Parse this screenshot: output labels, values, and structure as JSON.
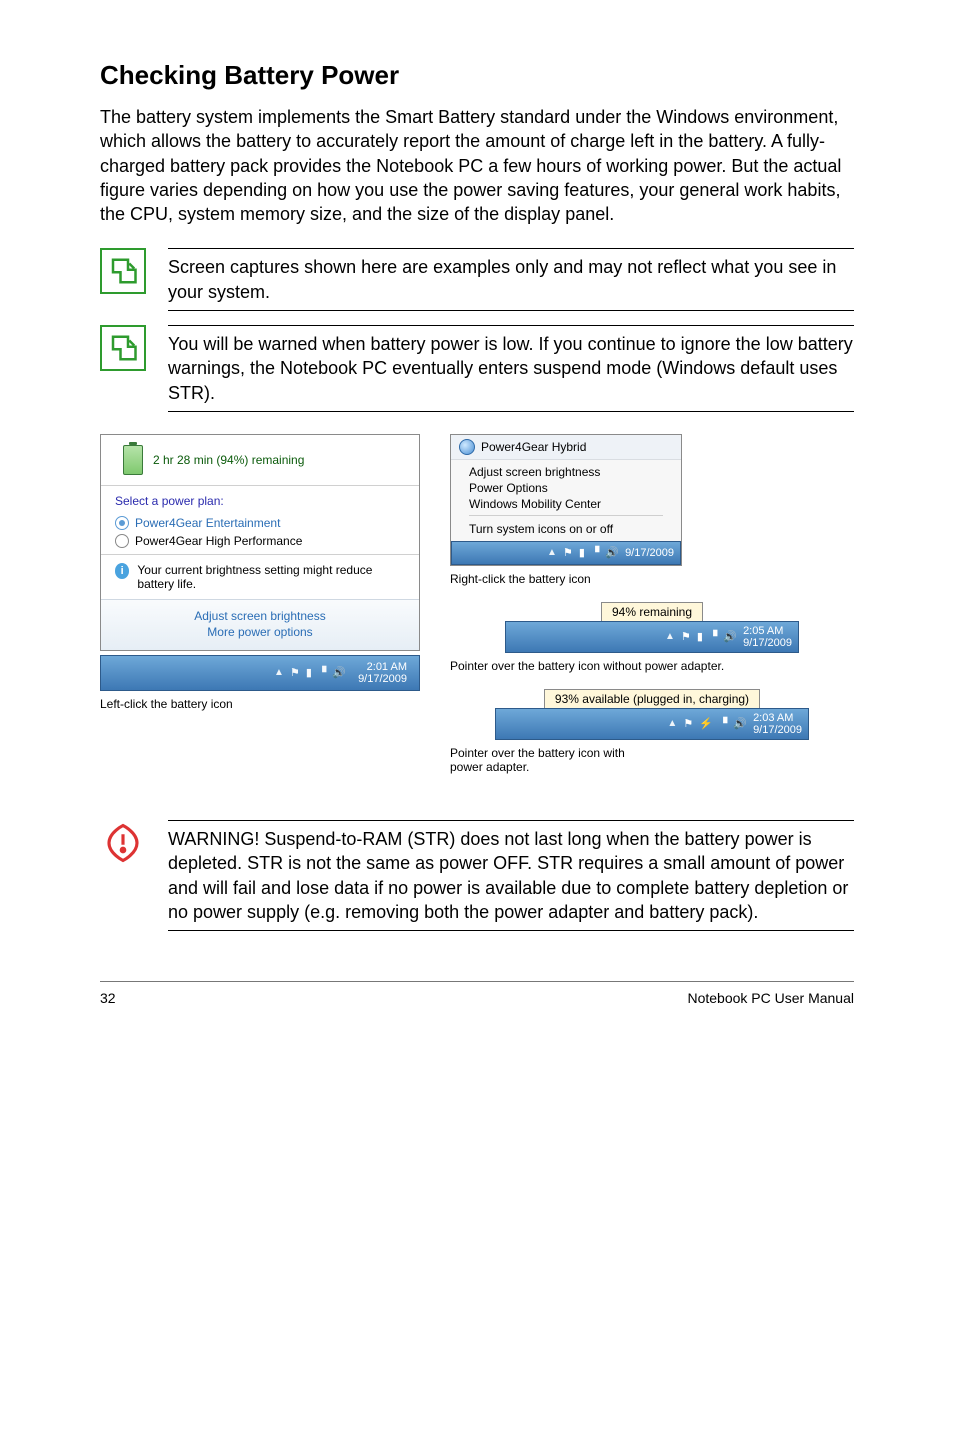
{
  "title": "Checking Battery Power",
  "intro": "The battery system implements the Smart Battery standard under the Windows environment, which allows the battery to accurately report the amount of charge left in the battery. A fully-charged battery pack provides the Notebook PC a few hours of working power. But the actual figure varies depending on how you use the power saving features, your general work habits, the CPU, system memory size, and the size of the display panel.",
  "notes": {
    "note1": "Screen captures shown here are examples only and may not reflect what you see in your system.",
    "note2": "You will be warned when battery power is low. If you continue to ignore the low battery warnings, the Notebook PC eventually enters suspend mode (Windows default uses STR)."
  },
  "warning": "WARNING!  Suspend-to-RAM (STR) does not last long when the battery power is depleted. STR is not the same as power OFF. STR requires a small amount of power and will fail and lose data if no power is available due to complete battery depletion or no power supply (e.g. removing both the power adapter and battery pack).",
  "left_popup": {
    "remaining": "2 hr 28 min (94%) remaining",
    "plan_label": "Select a power plan:",
    "plan1": "Power4Gear Entertainment",
    "plan2": "Power4Gear High Performance",
    "brightness_note": "Your current brightness setting might reduce battery life.",
    "link1": "Adjust screen brightness",
    "link2": "More power options"
  },
  "left_taskbar": {
    "time": "2:01 AM",
    "date": "9/17/2009"
  },
  "left_caption": "Left-click the battery icon",
  "right_menu": {
    "title": "Power4Gear Hybrid",
    "item1": "Adjust screen brightness",
    "item2": "Power Options",
    "item3": "Windows Mobility Center",
    "item4": "Turn system icons on or off",
    "tb_date": "9/17/2009"
  },
  "right_caption1": "Right-click the battery icon",
  "tooltip1": "94% remaining",
  "taskbar1": {
    "time": "2:05 AM",
    "date": "9/17/2009"
  },
  "right_caption2": "Pointer over the battery icon without power adapter.",
  "tooltip2": "93% available (plugged in, charging)",
  "taskbar2": {
    "time": "2:03 AM",
    "date": "9/17/2009"
  },
  "right_caption3_l1": "Pointer over the battery icon with",
  "right_caption3_l2": "power adapter.",
  "footer": {
    "page": "32",
    "manual": "Notebook PC User Manual"
  }
}
